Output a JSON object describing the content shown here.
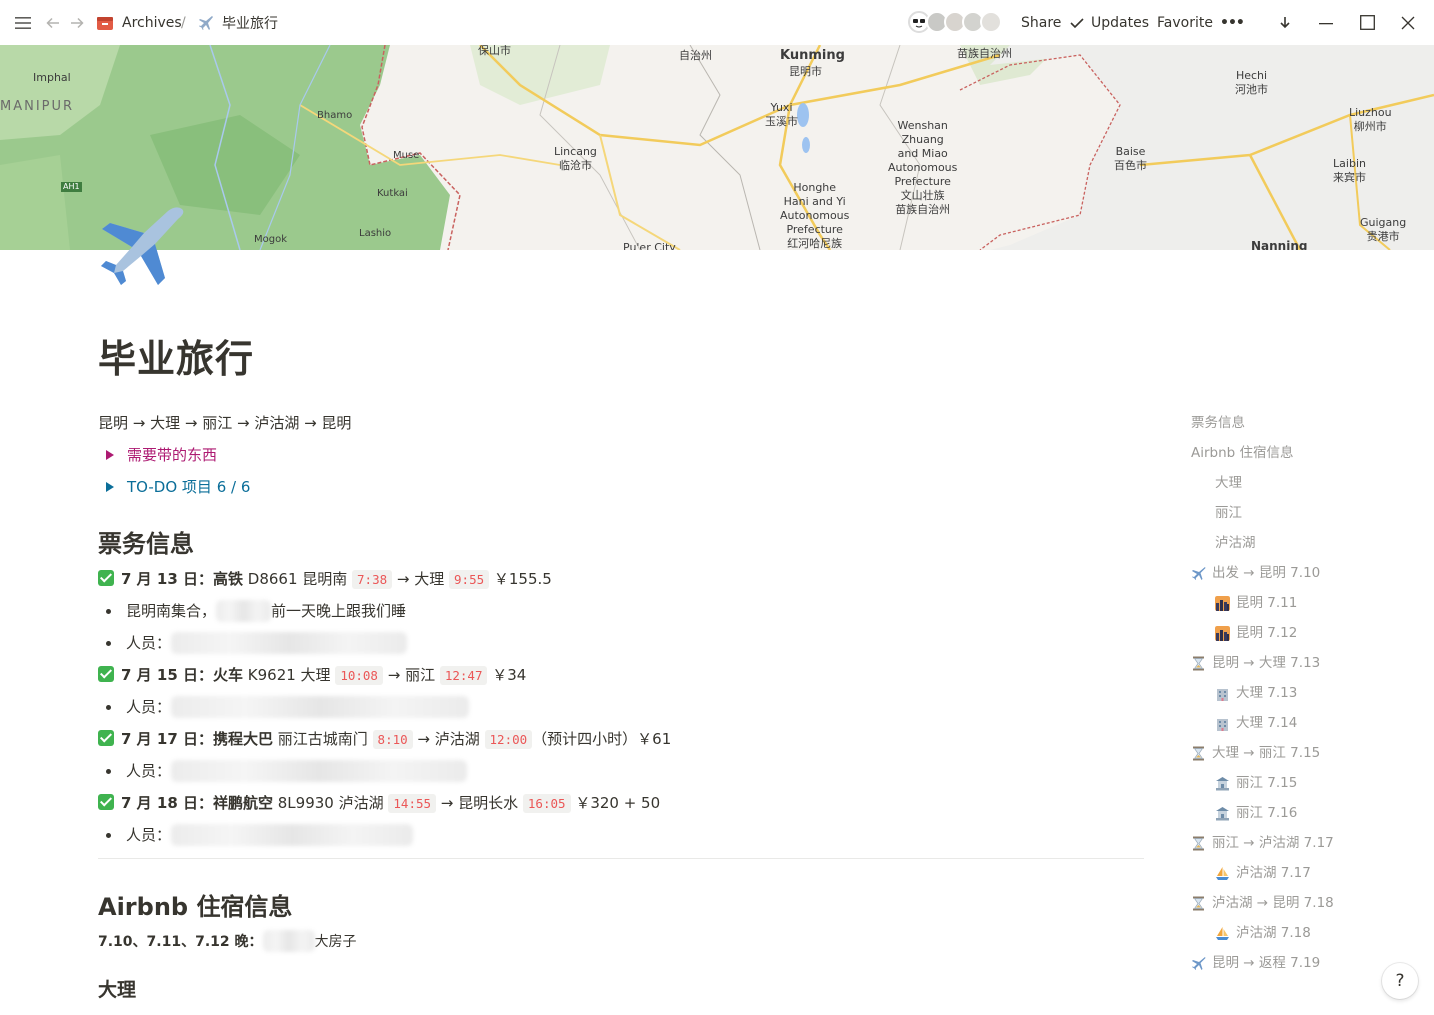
{
  "topbar": {
    "breadcrumb_parent": "Archives",
    "breadcrumb_sep": "/",
    "breadcrumb_current": "毕业旅行",
    "share": "Share",
    "updates": "Updates",
    "favorite": "Favorite",
    "more": "•••"
  },
  "cover": {
    "labels": {
      "imphal": "Imphal",
      "manipur": "MANIPUR",
      "ah1": "AH1",
      "bhamo": "Bhamo",
      "muse": "Muse",
      "kutkai": "Kutkai",
      "mogok": "Mogok",
      "lashio": "Lashio",
      "baoshan": "保山市",
      "lincang": "Lincang\n临沧市",
      "zizhizhou": "自治州",
      "kunming": "Kunming",
      "kunming_cn": "昆明市",
      "yuxi": "Yuxi\n玉溪市",
      "honghe": "Honghe\nHani and Yi\nAutonomous\nPrefecture\n红河哈尼族",
      "wenshan": "Wenshan\nZhuang\nand Miao\nAutonomous\nPrefecture\n文山壮族\n苗族自治州",
      "miaozu": "苗族自治州",
      "puer": "Pu'er City",
      "baise": "Baise\n百色市",
      "hechi": "Hechi\n河池市",
      "liuzhou": "Liuzhou\n柳州市",
      "laibin": "Laibin\n来宾市",
      "guigang": "Guigang\n贵港市",
      "nanning": "Nanning"
    }
  },
  "page": {
    "title": "毕业旅行",
    "route": "昆明 → 大理 → 丽江 → 泸沽湖 → 昆明",
    "toggle_things": "需要带的东西",
    "toggle_todo": "TO-DO 项目 6 / 6",
    "colors": {
      "toggle_things": "#ad1a72",
      "toggle_todo": "#0b6e99",
      "code_red": "#eb5757"
    }
  },
  "tickets": {
    "heading": "票务信息",
    "t1": {
      "date": "7 月 13 日：",
      "type": "高铁",
      "rest1": " D8661 昆明南 ",
      "dep": "7:38",
      "arrow": " → 大理 ",
      "arr": "9:55",
      "price": " ￥155.5"
    },
    "t1_note_a": "昆明南集合，",
    "t1_note_b": "前一天晚上跟我们睡",
    "person_label": "人员：",
    "t2": {
      "date": "7 月 15 日：",
      "type": "火车",
      "rest1": " K9621 大理 ",
      "dep": "10:08",
      "arrow": " → 丽江 ",
      "arr": "12:47",
      "price": " ￥34"
    },
    "t3": {
      "date": "7 月 17 日：",
      "type": "携程大巴",
      "rest1": " 丽江古城南门 ",
      "dep": "8:10",
      "arrow": " → 泸沽湖 ",
      "arr": "12:00",
      "price": "（预计四小时）￥61"
    },
    "t4": {
      "date": "7 月 18 日：",
      "type": "祥鹏航空",
      "rest1": " 8L9930 泸沽湖 ",
      "dep": "14:55",
      "arrow": " → 昆明长水 ",
      "arr": "16:05",
      "price": " ￥320 + 50"
    }
  },
  "airbnb": {
    "heading": "Airbnb 住宿信息",
    "line_bold": "7.10、7.11、7.12 晚：",
    "line_rest": "大房子",
    "sub_heading": "大理"
  },
  "toc": [
    {
      "label": "票务信息",
      "icon": ""
    },
    {
      "label": "Airbnb 住宿信息",
      "icon": ""
    },
    {
      "label": "大理",
      "icon": ""
    },
    {
      "label": "丽江",
      "icon": ""
    },
    {
      "label": "泸沽湖",
      "icon": ""
    },
    {
      "label": "出发 → 昆明 7.10",
      "icon": "airplane-icon"
    },
    {
      "label": "昆明 7.11",
      "icon": "city-sunset-icon"
    },
    {
      "label": "昆明 7.12",
      "icon": "city-sunset-icon"
    },
    {
      "label": "昆明 → 大理 7.13",
      "icon": "hourglass-icon"
    },
    {
      "label": "大理 7.13",
      "icon": "hotel-icon"
    },
    {
      "label": "大理 7.14",
      "icon": "hotel-icon"
    },
    {
      "label": "大理 → 丽江 7.15",
      "icon": "hourglass-icon"
    },
    {
      "label": "丽江 7.15",
      "icon": "temple-icon"
    },
    {
      "label": "丽江 7.16",
      "icon": "temple-icon"
    },
    {
      "label": "丽江 → 泸沽湖 7.17",
      "icon": "hourglass-icon"
    },
    {
      "label": "泸沽湖 7.17",
      "icon": "sailboat-icon"
    },
    {
      "label": "泸沽湖 → 昆明 7.18",
      "icon": "hourglass-icon"
    },
    {
      "label": "泸沽湖 7.18",
      "icon": "sailboat-icon"
    },
    {
      "label": "昆明 → 返程 7.19",
      "icon": "airplane-icon"
    }
  ],
  "help": "?"
}
